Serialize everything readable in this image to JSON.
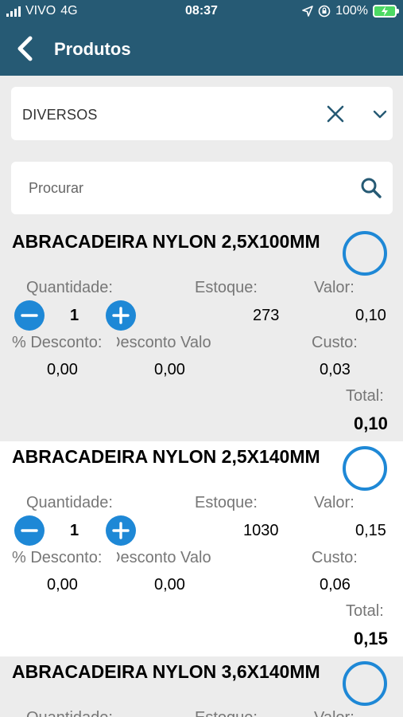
{
  "status": {
    "carrier": "VIVO",
    "network": "4G",
    "time": "08:37",
    "battery": "100%",
    "icons": [
      "signal-icon",
      "location-icon",
      "orientation-lock-icon",
      "battery-charging-icon"
    ]
  },
  "header": {
    "title": "Produtos",
    "back_icon": "chevron-left-icon"
  },
  "filter": {
    "value": "DIVERSOS",
    "clear_icon": "close-icon",
    "expand_icon": "chevron-down-icon"
  },
  "search": {
    "placeholder": "Procurar",
    "icon": "search-icon"
  },
  "labels": {
    "quantity": "Quantidade:",
    "stock": "Estoque:",
    "value": "Valor:",
    "discount_pct": "% Desconto:",
    "discount_value": "Desconto Valo",
    "cost": "Custo:",
    "total": "Total:"
  },
  "colors": {
    "header": "#265a74",
    "accent": "#1e88d6"
  },
  "products": [
    {
      "name": "ABRACADEIRA NYLON 2,5X100MM",
      "quantity": "1",
      "stock": "273",
      "value": "0,10",
      "discount_pct": "0,00",
      "discount_value": "0,00",
      "cost": "0,03",
      "total": "0,10"
    },
    {
      "name": "ABRACADEIRA NYLON 2,5X140MM",
      "quantity": "1",
      "stock": "1030",
      "value": "0,15",
      "discount_pct": "0,00",
      "discount_value": "0,00",
      "cost": "0,06",
      "total": "0,15"
    },
    {
      "name": "ABRACADEIRA NYLON 3,6X140MM"
    }
  ]
}
